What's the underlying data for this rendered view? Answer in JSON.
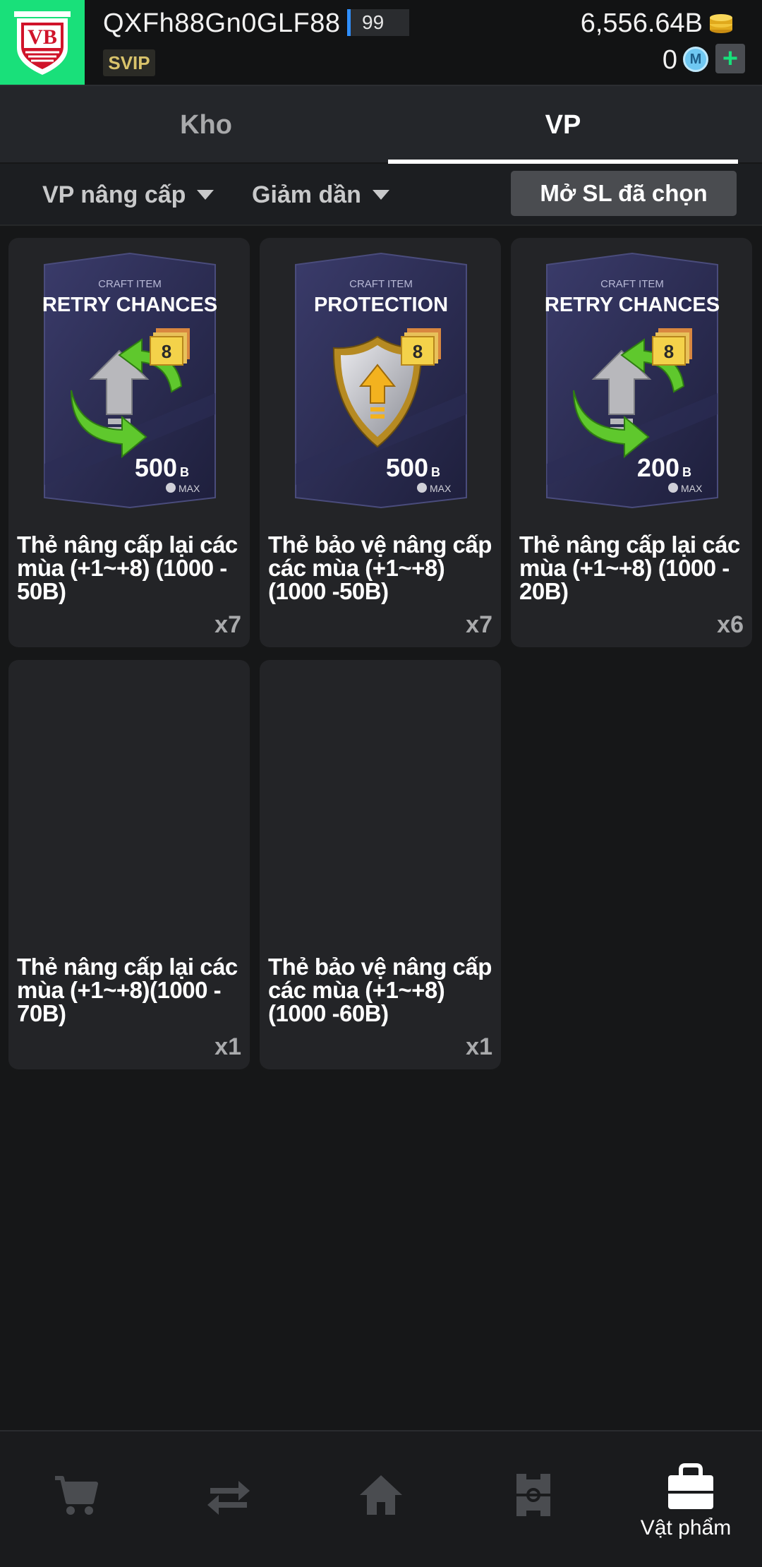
{
  "header": {
    "username": "QXFh88Gn0GLF88",
    "level": "99",
    "badge": "SVIP",
    "coins": "6,556.64B",
    "mcoins": "0",
    "mcoin_symbol": "M",
    "add_label": "+",
    "club_logo_text": "VB",
    "accent_color": "#19e07a"
  },
  "tabs": [
    {
      "label": "Kho",
      "active": false
    },
    {
      "label": "VP",
      "active": true
    }
  ],
  "filters": {
    "type_label": "VP nâng cấp",
    "sort_label": "Giảm dần",
    "open_button": "Mở SL đã chọn"
  },
  "items": [
    {
      "art_caption": "CRAFT ITEM",
      "art_title": "RETRY CHANCES",
      "art_level": "8",
      "art_value": "500",
      "art_unit": "B",
      "art_max": "MAX",
      "name": "Thẻ nâng cấp lại các mùa (+1~+8) (1000 - 50B)",
      "qty": "x7",
      "icon": "retry-arrows-icon"
    },
    {
      "art_caption": "CRAFT ITEM",
      "art_title": "PROTECTION",
      "art_level": "8",
      "art_value": "500",
      "art_unit": "B",
      "art_max": "MAX",
      "name": "Thẻ bảo vệ nâng cấp các mùa (+1~+8) (1000 -50B)",
      "qty": "x7",
      "icon": "shield-icon"
    },
    {
      "art_caption": "CRAFT ITEM",
      "art_title": "RETRY CHANCES",
      "art_level": "8",
      "art_value": "200",
      "art_unit": "B",
      "art_max": "MAX",
      "name": "Thẻ nâng cấp lại các mùa (+1~+8) (1000 - 20B)",
      "qty": "x6",
      "icon": "retry-arrows-icon"
    },
    {
      "name": "Thẻ nâng cấp lại các mùa (+1~+8)(1000 - 70B)",
      "qty": "x1"
    },
    {
      "name": "Thẻ bảo vệ nâng cấp các mùa (+1~+8)(1000 -60B)",
      "qty": "x1"
    }
  ],
  "bottom_nav": [
    {
      "icon": "cart-icon",
      "label": ""
    },
    {
      "icon": "transfer-icon",
      "label": ""
    },
    {
      "icon": "home-icon",
      "label": ""
    },
    {
      "icon": "formation-icon",
      "label": ""
    },
    {
      "icon": "bag-icon",
      "label": "Vật phẩm",
      "active": true
    }
  ]
}
